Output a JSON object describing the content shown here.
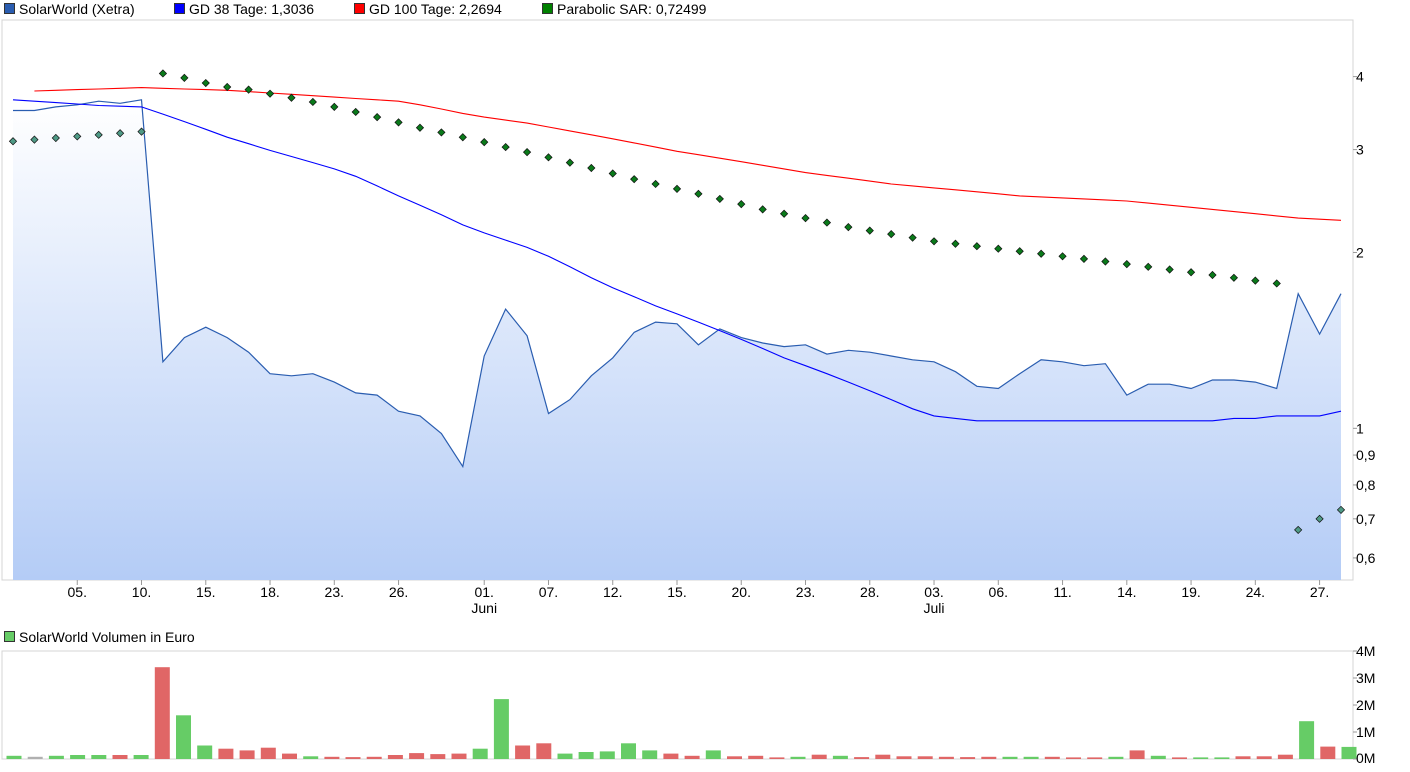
{
  "chart_data": [
    {
      "type": "line",
      "legend": [
        {
          "label": "SolarWorld (Xetra)",
          "color": "#2a5db0"
        },
        {
          "label": "GD 38 Tage: 1,3036",
          "color": "#0000ff"
        },
        {
          "label": "GD 100 Tage: 2,2694",
          "color": "#ff0000"
        },
        {
          "label": "Parabolic SAR: 0,72499",
          "color": "#008000"
        }
      ],
      "x_tick_labels": [
        "05.",
        "10.",
        "15.",
        "18.",
        "23.",
        "26.",
        "01.",
        "07.",
        "12.",
        "15.",
        "20.",
        "23.",
        "28.",
        "03.",
        "06.",
        "11.",
        "14.",
        "19.",
        "24.",
        "27."
      ],
      "x_tick_index": [
        3,
        6,
        9,
        12,
        15,
        18,
        22,
        25,
        28,
        31,
        34,
        37,
        40,
        43,
        46,
        49,
        52,
        55,
        58,
        61
      ],
      "month_labels": [
        {
          "label": "Juni",
          "index": 22
        },
        {
          "label": "Juli",
          "index": 43
        }
      ],
      "y_scale": "log",
      "y_ticks": [
        {
          "value": 4,
          "label": "4"
        },
        {
          "value": 3,
          "label": "3"
        },
        {
          "value": 2,
          "label": "2"
        },
        {
          "value": 1,
          "label": "1"
        },
        {
          "value": 0.9,
          "label": "0,9"
        },
        {
          "value": 0.8,
          "label": "0,8"
        },
        {
          "value": 0.7,
          "label": "0,7"
        },
        {
          "value": 0.6,
          "label": "0,6"
        }
      ],
      "ylim": [
        0.55,
        5.0
      ],
      "series": [
        {
          "name": "SolarWorld (Xetra)",
          "style": "area",
          "color": "#2a5db0",
          "values": [
            3.5,
            3.5,
            3.55,
            3.58,
            3.63,
            3.6,
            3.65,
            1.3,
            1.43,
            1.49,
            1.43,
            1.35,
            1.24,
            1.23,
            1.24,
            1.2,
            1.15,
            1.14,
            1.07,
            1.05,
            0.98,
            0.86,
            1.33,
            1.6,
            1.44,
            1.06,
            1.12,
            1.23,
            1.32,
            1.46,
            1.52,
            1.51,
            1.39,
            1.48,
            1.43,
            1.4,
            1.38,
            1.39,
            1.34,
            1.36,
            1.35,
            1.33,
            1.31,
            1.3,
            1.25,
            1.18,
            1.17,
            1.24,
            1.31,
            1.3,
            1.28,
            1.29,
            1.14,
            1.19,
            1.19,
            1.17,
            1.21,
            1.21,
            1.2,
            1.17,
            1.7,
            1.45,
            1.7
          ]
        },
        {
          "name": "GD 38 Tage: 1,3036",
          "style": "line",
          "color": "#0000ff",
          "values": [
            3.65,
            3.63,
            3.61,
            3.59,
            3.57,
            3.56,
            3.55,
            3.45,
            3.35,
            3.25,
            3.15,
            3.07,
            2.99,
            2.92,
            2.85,
            2.78,
            2.7,
            2.6,
            2.5,
            2.41,
            2.32,
            2.23,
            2.16,
            2.1,
            2.04,
            1.97,
            1.89,
            1.81,
            1.74,
            1.68,
            1.62,
            1.57,
            1.52,
            1.47,
            1.42,
            1.37,
            1.32,
            1.28,
            1.24,
            1.2,
            1.16,
            1.12,
            1.08,
            1.05,
            1.04,
            1.03,
            1.03,
            1.03,
            1.03,
            1.03,
            1.03,
            1.03,
            1.03,
            1.03,
            1.03,
            1.03,
            1.03,
            1.04,
            1.04,
            1.05,
            1.05,
            1.05,
            1.07
          ]
        },
        {
          "name": "GD 100 Tage: 2,2694",
          "style": "line",
          "color": "#ff0000",
          "values": [
            null,
            3.78,
            3.79,
            3.8,
            3.81,
            3.82,
            3.83,
            3.82,
            3.81,
            3.8,
            3.79,
            3.77,
            3.75,
            3.73,
            3.71,
            3.69,
            3.67,
            3.65,
            3.63,
            3.58,
            3.52,
            3.46,
            3.41,
            3.37,
            3.33,
            3.28,
            3.23,
            3.18,
            3.13,
            3.08,
            3.03,
            2.98,
            2.94,
            2.9,
            2.86,
            2.82,
            2.78,
            2.74,
            2.71,
            2.68,
            2.65,
            2.62,
            2.6,
            2.58,
            2.56,
            2.54,
            2.52,
            2.5,
            2.49,
            2.48,
            2.47,
            2.46,
            2.45,
            2.43,
            2.41,
            2.39,
            2.37,
            2.35,
            2.33,
            2.31,
            2.29,
            2.28,
            2.27
          ]
        },
        {
          "name": "Parabolic SAR: 0,72499",
          "style": "dots",
          "color": "#008000",
          "values": [
            3.1,
            3.12,
            3.14,
            3.16,
            3.18,
            3.2,
            3.22,
            4.05,
            3.98,
            3.9,
            3.84,
            3.8,
            3.74,
            3.68,
            3.62,
            3.55,
            3.48,
            3.41,
            3.34,
            3.27,
            3.21,
            3.15,
            3.09,
            3.03,
            2.97,
            2.91,
            2.85,
            2.79,
            2.73,
            2.67,
            2.62,
            2.57,
            2.52,
            2.47,
            2.42,
            2.37,
            2.33,
            2.29,
            2.25,
            2.21,
            2.18,
            2.15,
            2.12,
            2.09,
            2.07,
            2.05,
            2.03,
            2.01,
            1.99,
            1.97,
            1.95,
            1.93,
            1.91,
            1.89,
            1.87,
            1.85,
            1.83,
            1.81,
            1.79,
            1.77,
            0.67,
            0.7,
            0.725
          ]
        }
      ]
    },
    {
      "type": "bar",
      "title": "SolarWorld Volumen in Euro",
      "legend": [
        {
          "label": "SolarWorld Volumen in Euro",
          "color": "#66cc66"
        }
      ],
      "unit": "Mio. Euro",
      "y_ticks": [
        {
          "value": 4,
          "label": "4M"
        },
        {
          "value": 3,
          "label": "3M"
        },
        {
          "value": 2,
          "label": "2M"
        },
        {
          "value": 1,
          "label": "1M"
        },
        {
          "value": 0,
          "label": "0M"
        }
      ],
      "ylim": [
        0,
        4
      ],
      "up_color": "#66cc66",
      "down_color": "#e06666",
      "neutral_color": "#b0b0b0",
      "values": [
        0.12,
        0.08,
        0.12,
        0.15,
        0.15,
        0.15,
        0.15,
        3.4,
        1.62,
        0.5,
        0.38,
        0.32,
        0.42,
        0.2,
        0.1,
        0.08,
        0.07,
        0.08,
        0.15,
        0.22,
        0.18,
        0.2,
        0.38,
        2.22,
        0.5,
        0.58,
        0.2,
        0.26,
        0.28,
        0.58,
        0.32,
        0.2,
        0.12,
        0.32,
        0.1,
        0.12,
        0.06,
        0.08,
        0.16,
        0.12,
        0.07,
        0.16,
        0.1,
        0.1,
        0.08,
        0.07,
        0.08,
        0.08,
        0.08,
        0.08,
        0.06,
        0.06,
        0.08,
        0.32,
        0.12,
        0.06,
        0.06,
        0.06,
        0.1,
        0.1,
        0.16,
        1.4,
        0.46,
        0.45
      ],
      "direction": [
        "up",
        "neutral",
        "up",
        "up",
        "up",
        "down",
        "up",
        "down",
        "up",
        "up",
        "down",
        "down",
        "down",
        "down",
        "up",
        "down",
        "down",
        "down",
        "down",
        "down",
        "down",
        "down",
        "up",
        "up",
        "down",
        "down",
        "up",
        "up",
        "up",
        "up",
        "up",
        "down",
        "down",
        "up",
        "down",
        "down",
        "down",
        "up",
        "down",
        "up",
        "down",
        "down",
        "down",
        "down",
        "down",
        "down",
        "down",
        "up",
        "up",
        "down",
        "down",
        "down",
        "up",
        "down",
        "up",
        "down",
        "up",
        "up",
        "down",
        "down",
        "down",
        "up",
        "down",
        "up"
      ]
    }
  ]
}
